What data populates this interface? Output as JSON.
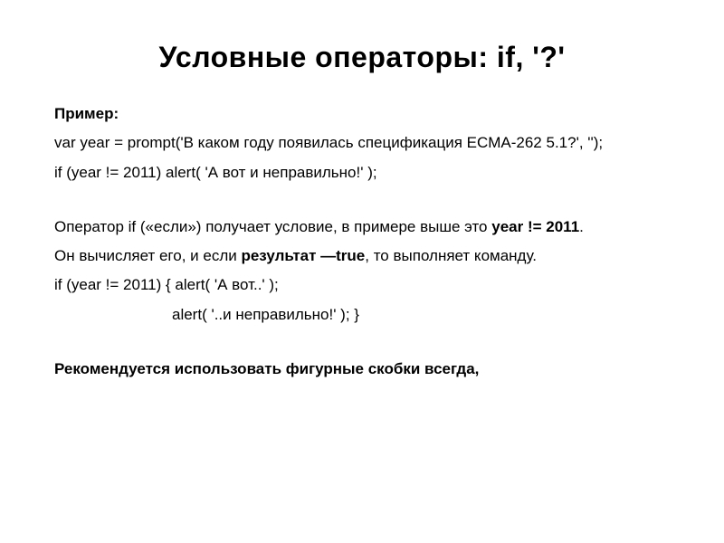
{
  "title": "Условные операторы: if, '?'",
  "label_example": "Пример:",
  "code1": "var year = prompt('В каком году появилась спецификация ECMA-262 5.1?', '');",
  "code2": "if (year != 2011) alert( 'А вот и неправильно!' );",
  "explain1_a": "Оператор if («если») получает условие, в примере выше это ",
  "explain1_b": "year != 2011",
  "explain1_c": ".",
  "explain2_a": "Он вычисляет его, и если ",
  "explain2_b": "результат —true",
  "explain2_c": ", то выполняет команду.",
  "code3": "if (year != 2011) { alert( 'А вот..' );",
  "code4": "alert( '..и неправильно!' ); }",
  "recommend": "Рекомендуется использовать фигурные скобки всегда,"
}
